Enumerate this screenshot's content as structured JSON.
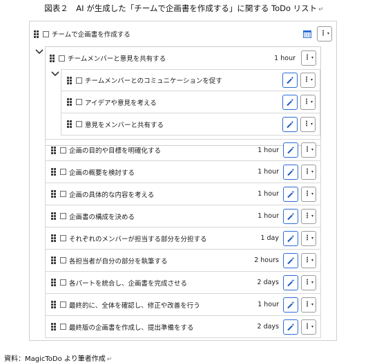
{
  "figure": {
    "title": "図表２　AI が生成した「チームで企画書を作成する」に関する ToDo リスト",
    "return_mark": "↵"
  },
  "root_task": {
    "label": "チームで企画書を作成する"
  },
  "subtasks": [
    {
      "label": "チームメンバーと意見を共有する",
      "duration": "1 hour",
      "children": [
        {
          "label": "チームメンバーとのコミュニケーションを促す"
        },
        {
          "label": "アイデアや意見を考える"
        },
        {
          "label": "意見をメンバーと共有する"
        }
      ]
    },
    {
      "label": "企画の目的や目標を明確化する",
      "duration": "1 hour"
    },
    {
      "label": "企画の概要を検討する",
      "duration": "1 hour"
    },
    {
      "label": "企画の具体的な内容を考える",
      "duration": "1 hour"
    },
    {
      "label": "企画書の構成を決める",
      "duration": "1 hour"
    },
    {
      "label": "それぞれのメンバーが担当する部分を分担する",
      "duration": "1 day"
    },
    {
      "label": "各担当者が自分の部分を執筆する",
      "duration": "2 hours"
    },
    {
      "label": "各パートを統合し、企画書を完成させる",
      "duration": "2 days"
    },
    {
      "label": "最終的に、全体を確認し、修正や改善を行う",
      "duration": "1 hour"
    },
    {
      "label": "最終版の企画書を作成し、提出準備をする",
      "duration": "2 days"
    }
  ],
  "source": {
    "text": "資料：MagicToDo より筆者作成"
  },
  "colors": {
    "accent": "#2b6cd6",
    "border": "#cfcfcf"
  },
  "icons": [
    "drag-handle-icon",
    "checkbox",
    "calendar-icon",
    "chevron-down-icon",
    "magic-wand-icon",
    "menu-dots-icon"
  ]
}
